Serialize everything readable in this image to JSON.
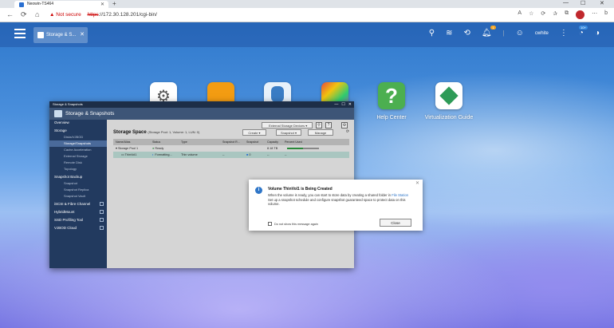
{
  "browser": {
    "tab_title": "Neowin-TS464",
    "new_tab": "+",
    "win_min": "—",
    "win_max": "☐",
    "win_close": "✕",
    "security_label": "Not secure",
    "url_scheme": "https",
    "url_rest": "://172.30.128.201/cgi-bin/"
  },
  "taskbar": {
    "window_tab": "Storage & S...",
    "user": "cwhite",
    "notif_count": "1",
    "updates_count": "10+"
  },
  "desktop_apps": [
    {
      "name": "Help Center"
    },
    {
      "name": "Virtualization Guide"
    }
  ],
  "window": {
    "titlebar": "Storage & Snapshots",
    "header": "Storage & Snapshots",
    "sidebar": [
      {
        "label": "Overview",
        "type": "head"
      },
      {
        "label": "Storage",
        "type": "head"
      },
      {
        "label": "Disks/VJBOD",
        "type": "sub"
      },
      {
        "label": "Storage/Snapshots",
        "type": "sub active"
      },
      {
        "label": "Cache Acceleration",
        "type": "sub"
      },
      {
        "label": "External Storage",
        "type": "sub"
      },
      {
        "label": "Remote Disk",
        "type": "sub"
      },
      {
        "label": "Topology",
        "type": "sub"
      },
      {
        "label": "Snapshot Backup",
        "type": "head"
      },
      {
        "label": "Snapshot",
        "type": "sub"
      },
      {
        "label": "Snapshot Replica",
        "type": "sub"
      },
      {
        "label": "Snapshot Vault",
        "type": "sub"
      },
      {
        "label": "iSCSI & Fibre Channel",
        "type": "head ext"
      },
      {
        "label": "HybridMount",
        "type": "head ext"
      },
      {
        "label": "SSD Profiling Tool",
        "type": "head ext"
      },
      {
        "label": "VJBOD Cloud",
        "type": "head ext"
      }
    ],
    "external_btn": "External Storage Devices",
    "storage_space_title": "Storage Space",
    "storage_space_sub": "(Storage Pool: 1, Volume: 1, LUN: 0)",
    "create_btn": "Create",
    "snapshot_btn": "Snapshot",
    "manage_btn": "Manage",
    "columns": [
      "Name/Alias",
      "Status",
      "Type",
      "Snapshot R...",
      "Snapshot",
      "Capacity",
      "Percent Used"
    ],
    "rows": [
      {
        "name": "Storage Pool 1",
        "status": "Ready",
        "type": "",
        "snap_r": "",
        "snap": "",
        "capacity": "8.18 TB",
        "used": "",
        "pct": 0.5
      },
      {
        "name": "ThinVol1",
        "status": "Formatting...",
        "type": "Thin volume",
        "snap_r": "--",
        "snap": "0",
        "capacity": "--",
        "used": "--",
        "pct": 0
      }
    ]
  },
  "dialog": {
    "title": "Volume ThinVol1 is Being Created",
    "body1": "When the volume is ready, you can start to store data by creating a shared folder in",
    "body_link": "File Station",
    "body2": "Set up a snapshot schedule and configure snapshot guaranteed space to protect data on this volume.",
    "checkbox": "Do not show this message again",
    "close": "Close"
  }
}
